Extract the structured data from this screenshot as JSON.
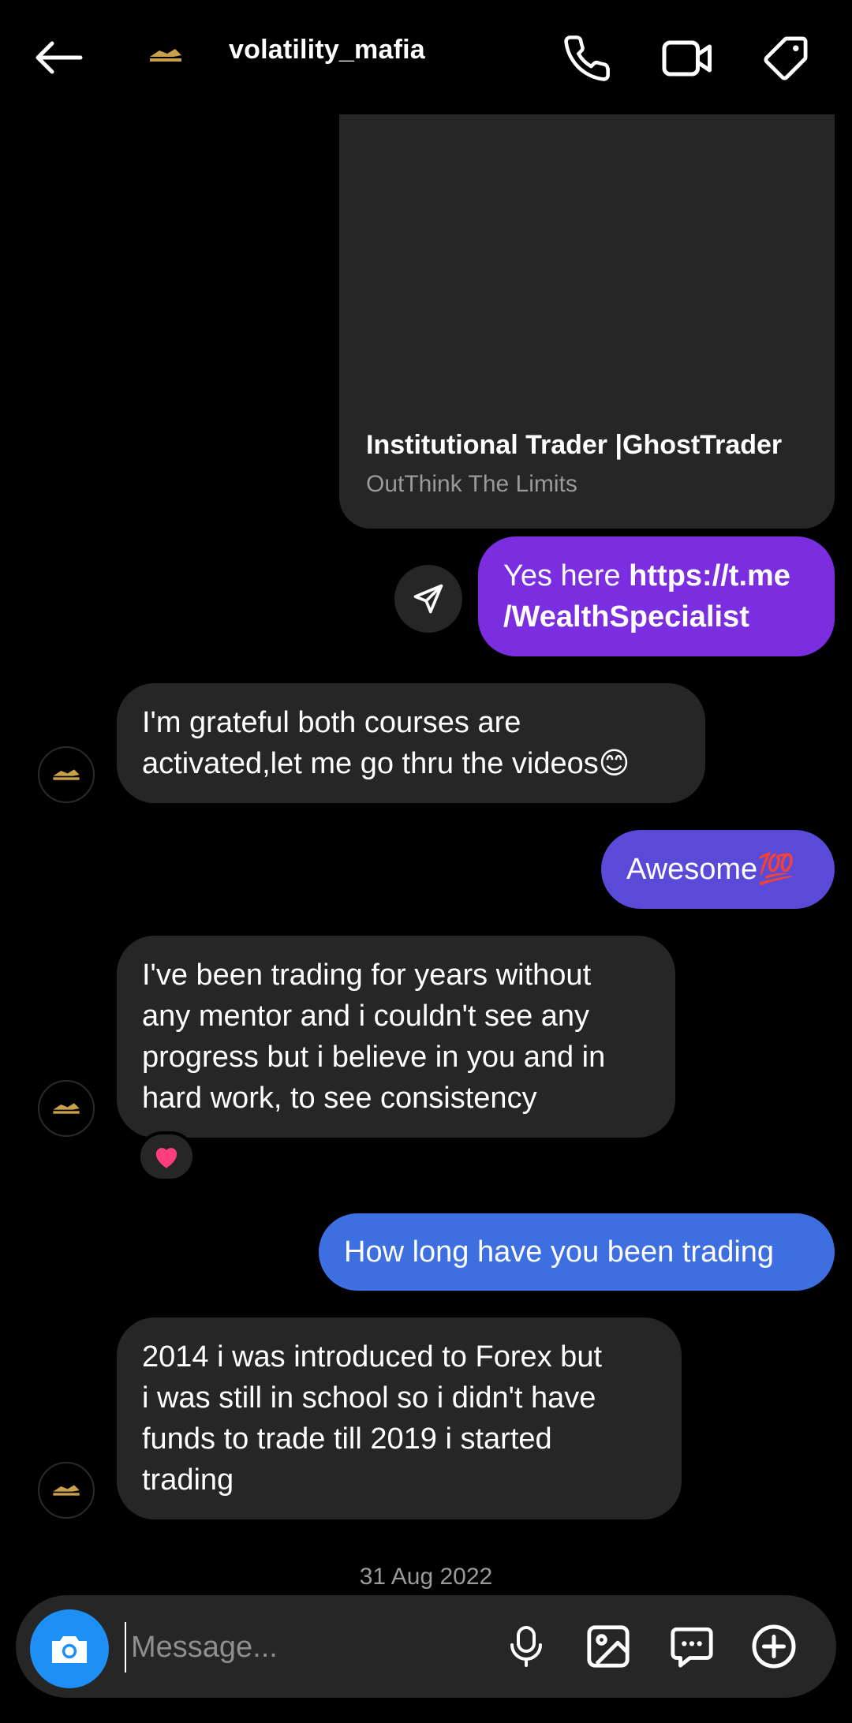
{
  "header": {
    "username": "volatility_mafia",
    "avatar_alt": "volatility mafia logo"
  },
  "shared_card": {
    "title": "Institutional Trader |GhostTrader",
    "subtitle": "OutThink The Limits"
  },
  "messages": [
    {
      "from": "me",
      "text_plain": "Yes here ",
      "link_line1": "https://t.me",
      "link_line2": "/WealthSpecialist"
    },
    {
      "from": "them",
      "line1": "I'm grateful both courses are",
      "line2": "activated,let me go thru the videos😊"
    },
    {
      "from": "me",
      "text": "Awesome💯"
    },
    {
      "from": "them",
      "line1": "I've been trading for years without",
      "line2": "any mentor and i couldn't  see any",
      "line3": "progress but i believe in you and in",
      "line4": "hard work, to see consistency",
      "reaction": "❤️"
    },
    {
      "from": "me",
      "text": "How long have you been trading"
    },
    {
      "from": "them",
      "line1": "2014 i was introduced to Forex but",
      "line2": "i was still in school so i didn't have",
      "line3": "funds to trade till 2019 i started",
      "line4": "trading"
    }
  ],
  "date_divider": "31 Aug 2022",
  "composer": {
    "placeholder": "Message..."
  },
  "colors": {
    "bubble_in": "#262626",
    "purple": "#7b2ee0",
    "indigo": "#5a4ad8",
    "blue": "#3d6fe0",
    "camera": "#1d8ff5"
  }
}
